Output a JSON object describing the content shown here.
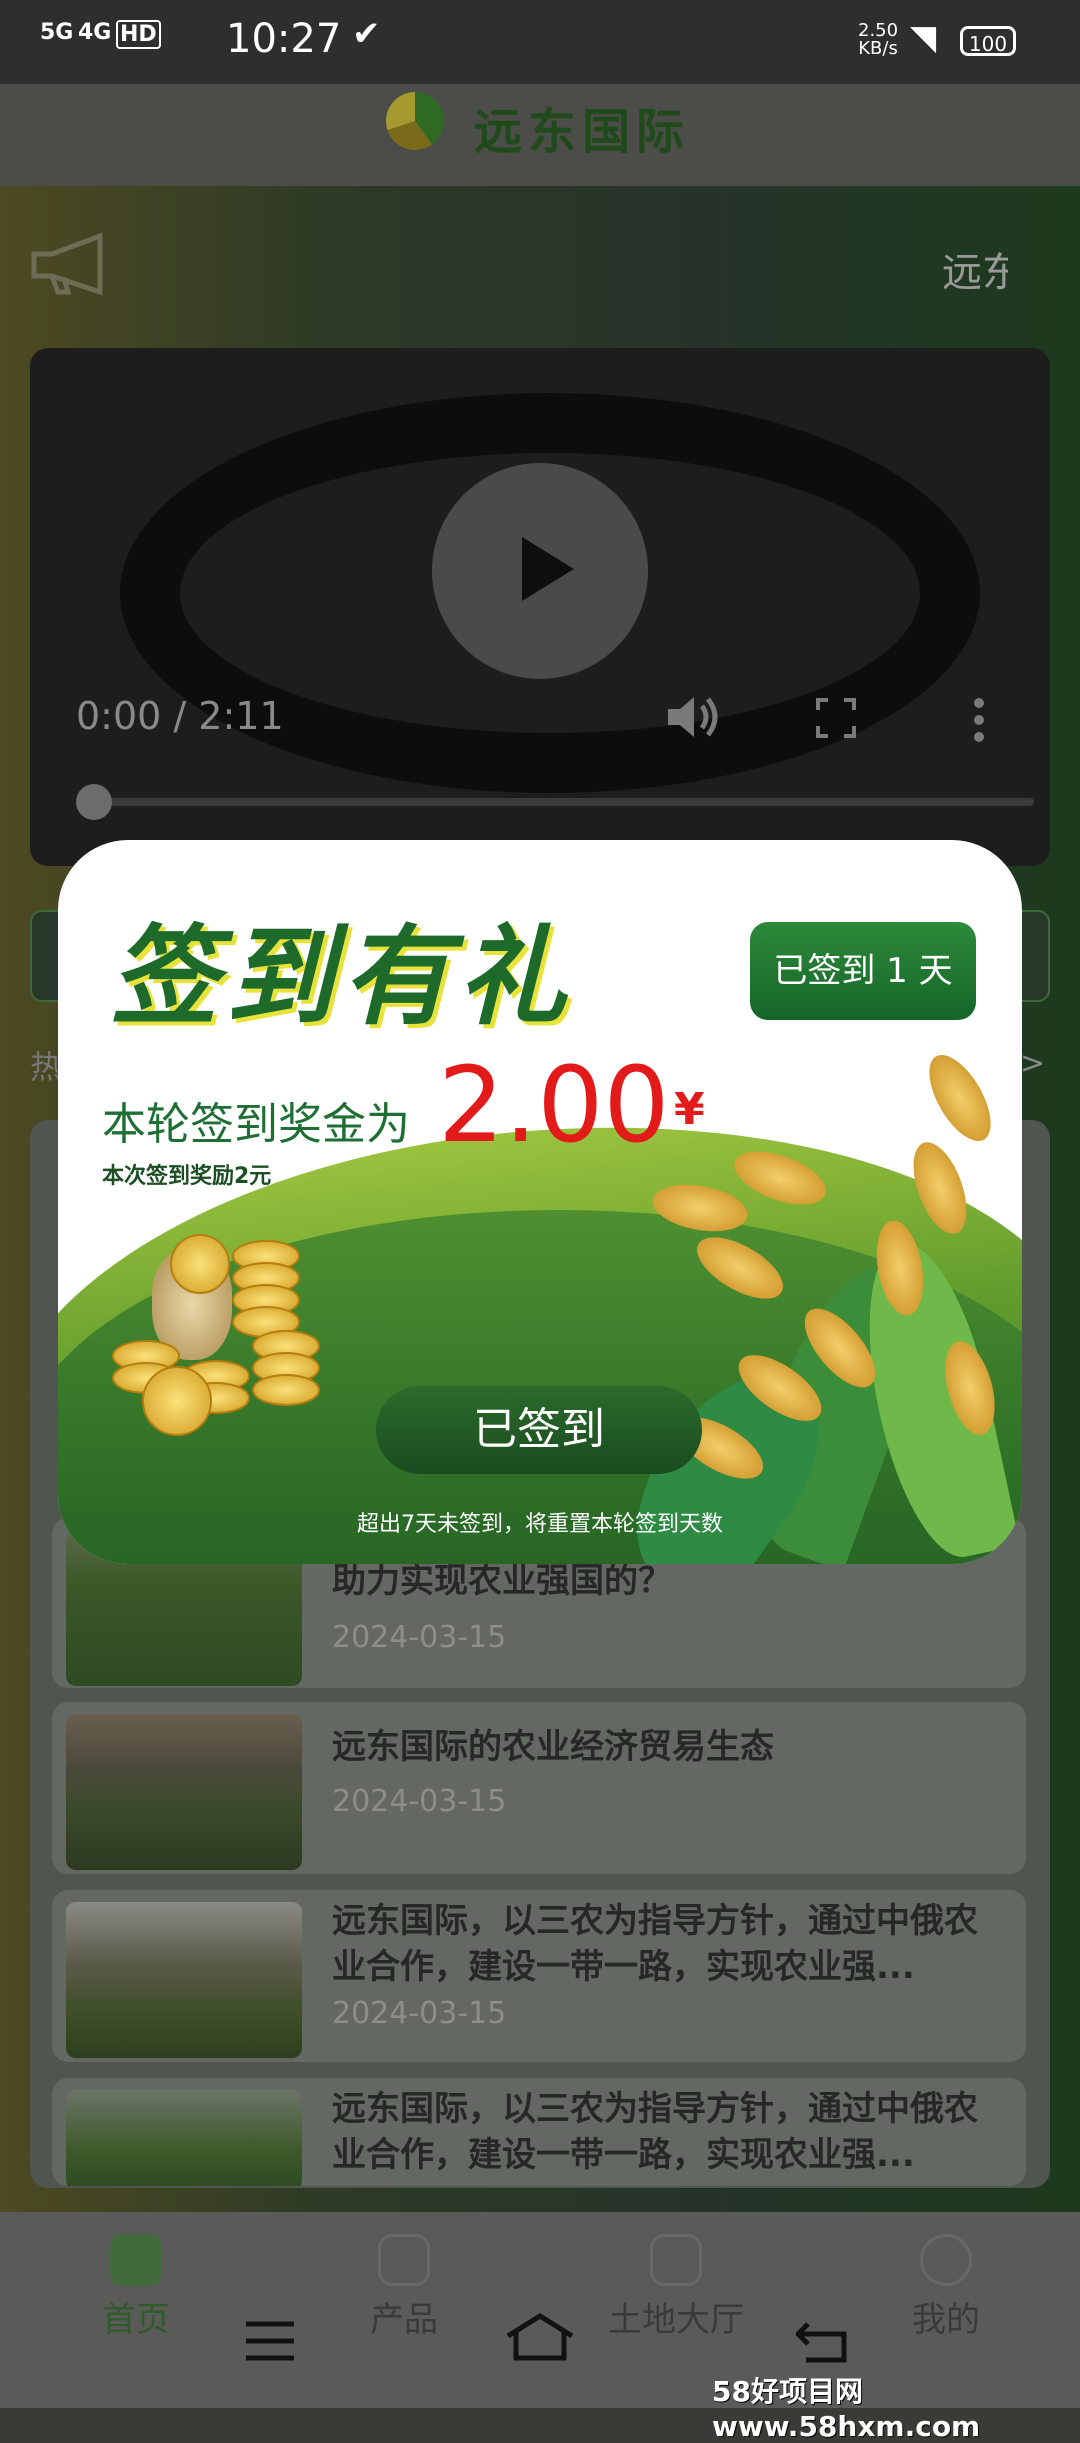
{
  "status_bar": {
    "signal1": "5G",
    "signal2": "4G",
    "hd": "HD",
    "time": "10:27",
    "speed_value": "2.50",
    "speed_unit": "KB/s",
    "battery": "100"
  },
  "app_header": {
    "title": "远东国际"
  },
  "notice": {
    "text": "远东"
  },
  "video": {
    "time": "0:00 / 2:11",
    "progress": 0
  },
  "section": {
    "hot_label": "热",
    "more": ">"
  },
  "news": [
    {
      "title": "助力实现农业强国的？",
      "date": "2024-03-15"
    },
    {
      "title": "远东国际的农业经济贸易生态",
      "date": "2024-03-15"
    },
    {
      "title": "远东国际，以三农为指导方针，通过中俄农业合作，建设一带一路，实现农业强...",
      "date": "2024-03-15"
    },
    {
      "title": "远东国际，以三农为指导方针，通过中俄农业合作，建设一带一路，实现农业强...",
      "date": ""
    }
  ],
  "nav": {
    "home": "首页",
    "products": "产品",
    "land_hall": "土地大厅",
    "mine": "我的"
  },
  "popup": {
    "title": "签到有礼",
    "signed_days": "已签到 1 天",
    "reward_label": "本轮签到奖金为",
    "reward_amount": "2.00",
    "reward_currency": "¥",
    "reward_sub": "本次签到奖励2元",
    "signed_button": "已签到",
    "reset_note": "超出7天未签到，将重置本轮签到天数"
  },
  "watermark": "58好项目网www.58hxm.com"
}
